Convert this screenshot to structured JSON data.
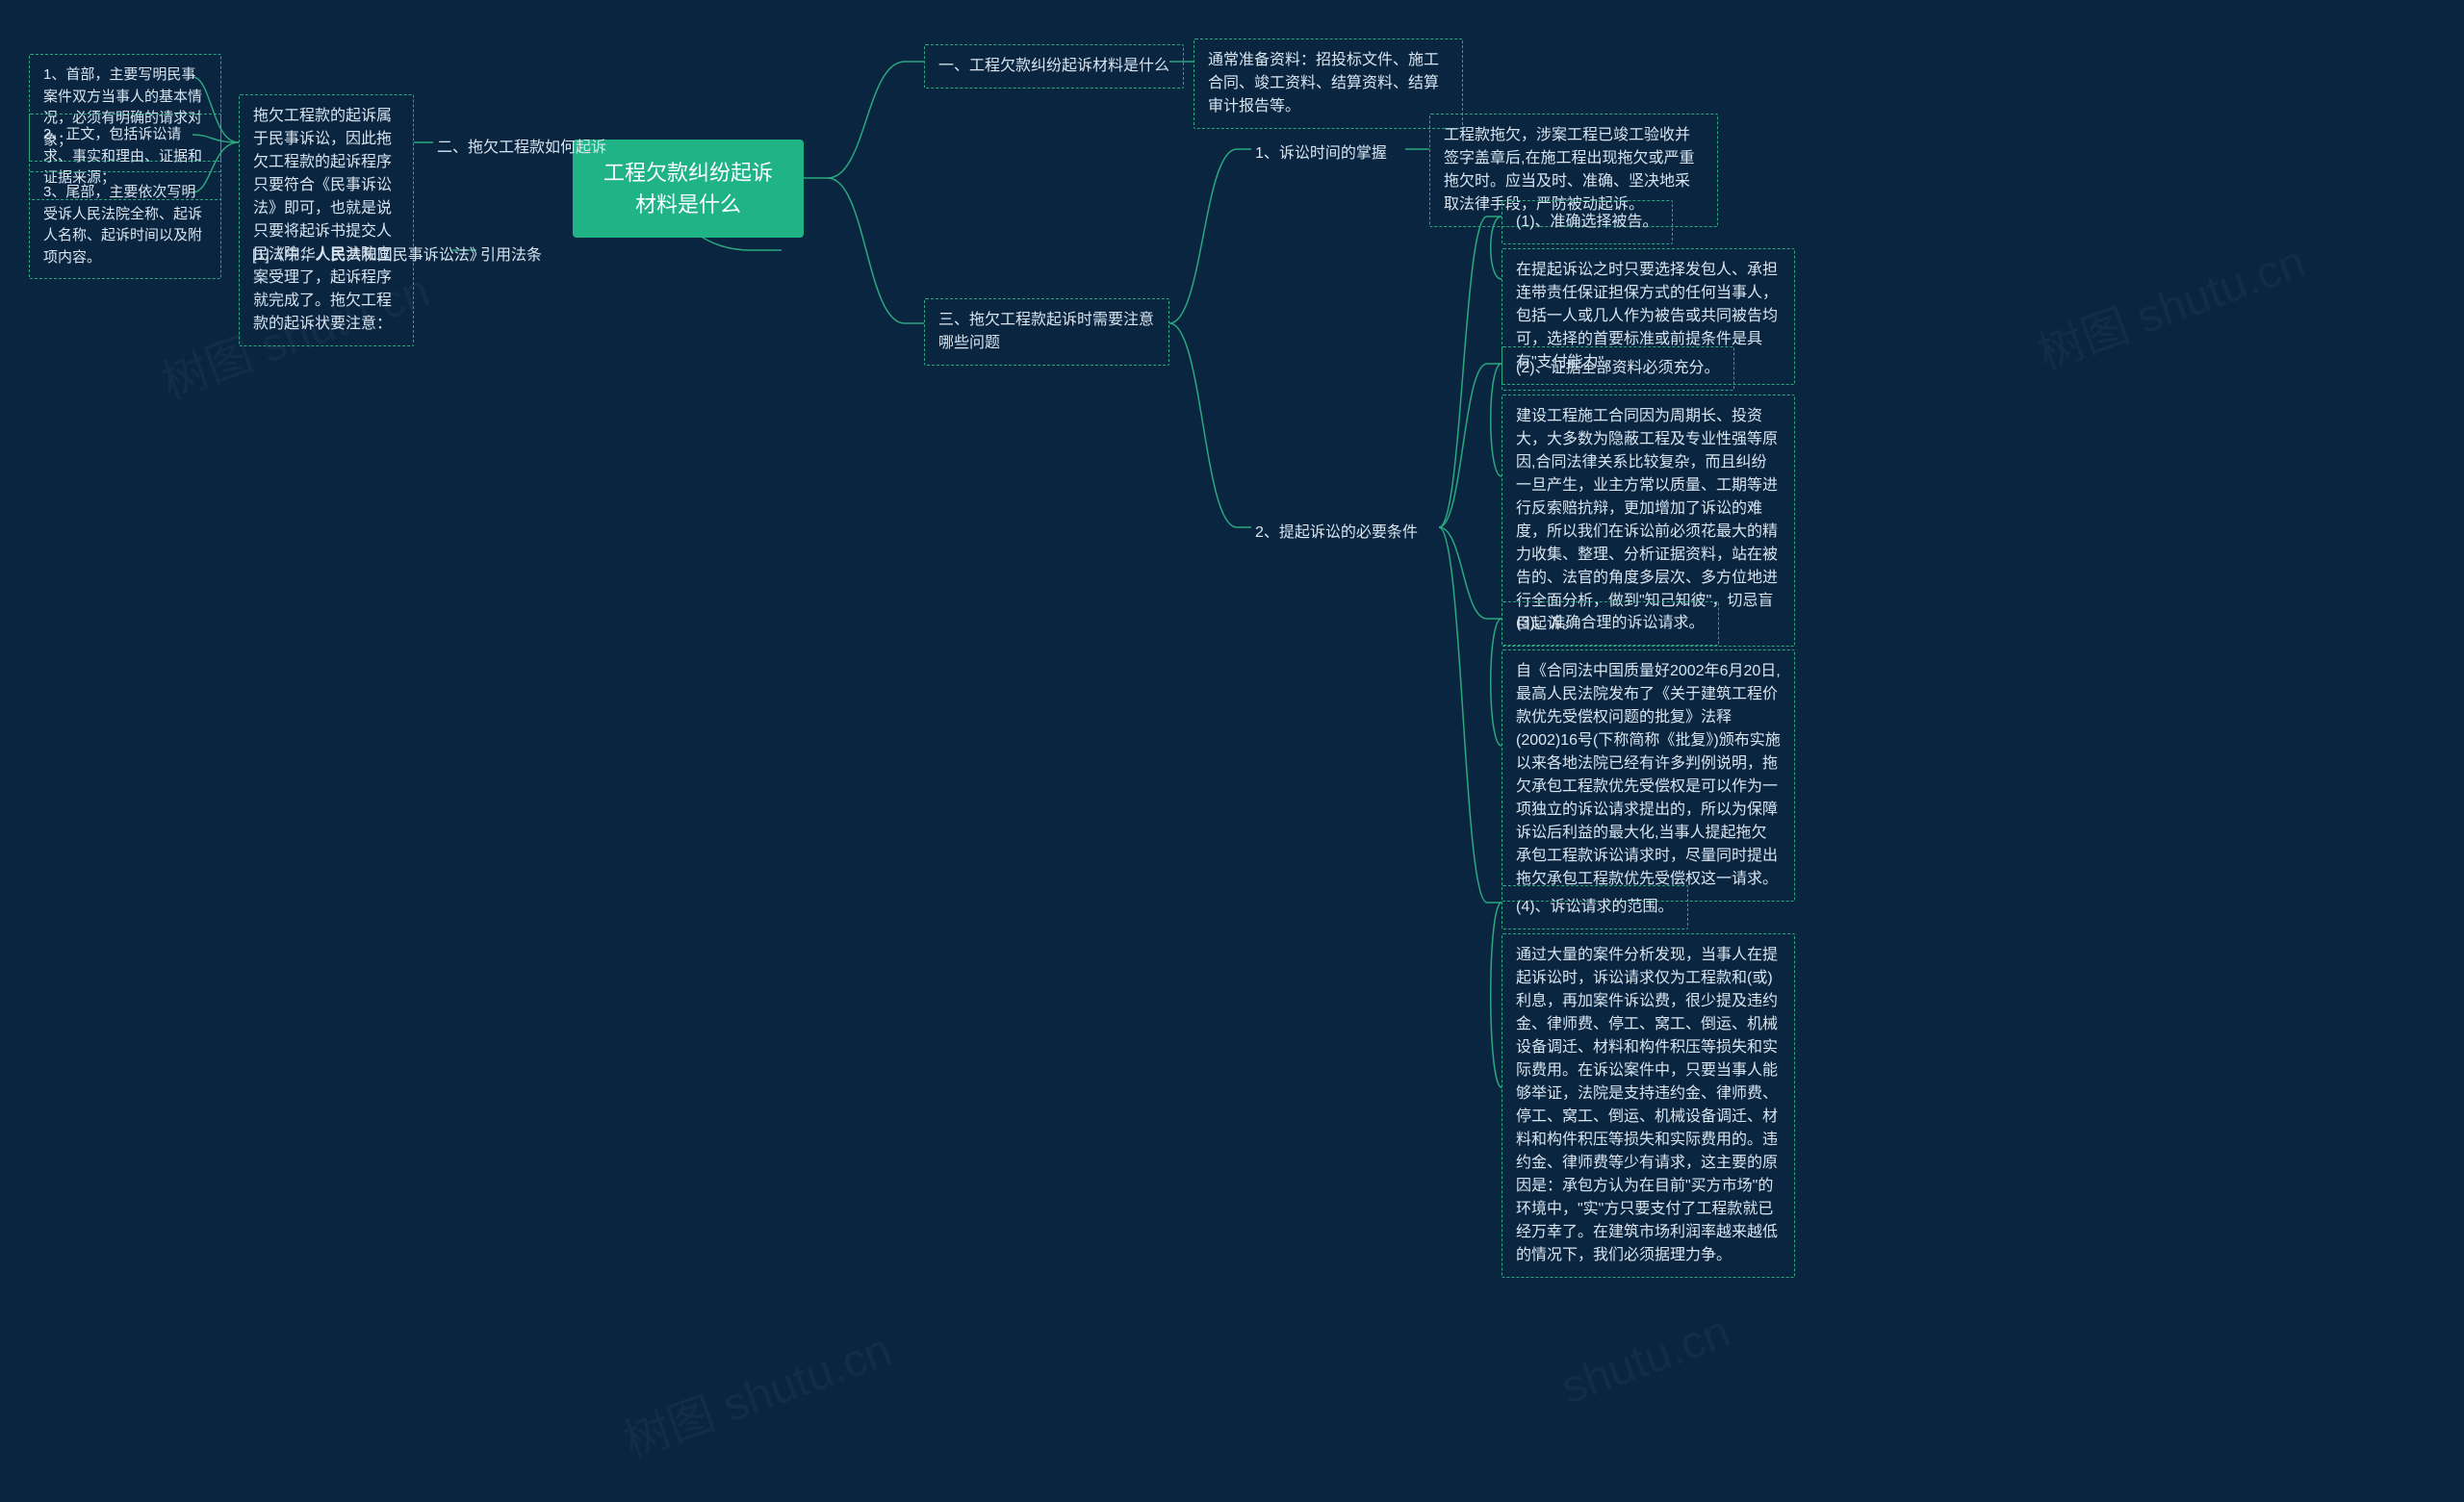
{
  "root": {
    "title": "工程欠款纠纷起诉材料是什么"
  },
  "branch_left": {
    "b2": {
      "label": "二、拖欠工程款如何起诉",
      "desc": "拖欠工程款的起诉属于民事诉讼，因此拖欠工程款的起诉程序只要符合《民事诉讼法》即可，也就是说只要将起诉书提交人民法院，人民法院立案受理了，起诉程序就完成了。拖欠工程款的起诉状要注意：",
      "items": {
        "i1": "1、首部，主要写明民事案件双方当事人的基本情况，必须有明确的请求对象；",
        "i2": "2、正文，包括诉讼请求、事实和理由、证据和证据来源；",
        "i3": "3、尾部，主要依次写明受诉人民法院全称、起诉人名称、起诉时间以及附项内容。"
      }
    },
    "ref": {
      "label": "引用法条",
      "item": "[1]《中华人民共和国民事诉讼法》"
    }
  },
  "branch_right": {
    "b1": {
      "label": "一、工程欠款纠纷起诉材料是什么",
      "desc": "通常准备资料：招投标文件、施工合同、竣工资料、结算资料、结算审计报告等。"
    },
    "b3": {
      "label": "三、拖欠工程款起诉时需要注意哪些问题",
      "sub1": {
        "label": "1、诉讼时间的掌握",
        "desc": "工程款拖欠，涉案工程已竣工验收并签字盖章后,在施工程出现拖欠或严重拖欠时。应当及时、准确、坚决地采取法律手段，严防被动起诉。"
      },
      "sub2": {
        "label": "2、提起诉讼的必要条件",
        "p1": {
          "title": "(1)、准确选择被告。",
          "desc": "在提起诉讼之时只要选择发包人、承担连带责任保证担保方式的任何当事人，包括一人或几人作为被告或共同被告均可，选择的首要标准或前提条件是具有\"支付能力\"。"
        },
        "p2": {
          "title": "(2)、证据全部资料必须充分。",
          "desc": "建设工程施工合同因为周期长、投资大，大多数为隐蔽工程及专业性强等原因,合同法律关系比较复杂，而且纠纷一旦产生，业主方常以质量、工期等进行反索赔抗辩，更加增加了诉讼的难度，所以我们在诉讼前必须花最大的精力收集、整理、分析证据资料，站在被告的、法官的角度多层次、多方位地进行全面分析，做到\"知己知彼\"，切忌盲目起诉。"
        },
        "p3": {
          "title": "(3)、准确合理的诉讼请求。",
          "desc": "自《合同法中国质量好2002年6月20日,最高人民法院发布了《关于建筑工程价款优先受偿权问题的批复》法释(2002)16号(下称简称《批复》)颁布实施以来各地法院已经有许多判例说明，拖欠承包工程款优先受偿权是可以作为一项独立的诉讼请求提出的，所以为保障诉讼后利益的最大化,当事人提起拖欠承包工程款诉讼请求时，尽量同时提出拖欠承包工程款优先受偿权这一请求。"
        },
        "p4": {
          "title": "(4)、诉讼请求的范围。",
          "desc": "通过大量的案件分析发现，当事人在提起诉讼时，诉讼请求仅为工程款和(或)利息，再加案件诉讼费，很少提及违约金、律师费、停工、窝工、倒运、机械设备调迁、材料和构件积压等损失和实际费用。在诉讼案件中，只要当事人能够举证，法院是支持违约金、律师费、停工、窝工、倒运、机械设备调迁、材料和构件积压等损失和实际费用的。违约金、律师费等少有请求，这主要的原因是：承包方认为在目前\"买方市场\"的环境中，\"实\"方只要支付了工程款就已经万幸了。在建筑市场利润率越来越低的情况下，我们必须据理力争。"
        }
      }
    }
  }
}
